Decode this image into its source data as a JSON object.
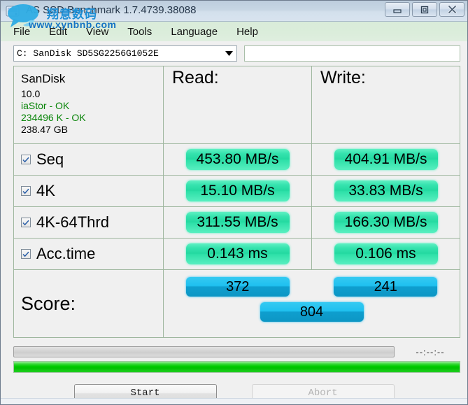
{
  "window": {
    "title": "AS SSD Benchmark 1.7.4739.38088",
    "minimize_label": "Minimize",
    "maximize_label": "Maximize",
    "close_label": "Close"
  },
  "watermark": {
    "chinese": "翔意数码",
    "url": "www.xynbnb.com",
    "color": "#1e8fd6"
  },
  "menu": {
    "items": [
      {
        "label": "File"
      },
      {
        "label": "Edit"
      },
      {
        "label": "View"
      },
      {
        "label": "Tools"
      },
      {
        "label": "Language"
      },
      {
        "label": "Help"
      }
    ]
  },
  "toolbar": {
    "drive_selected": "C: SanDisk SD5SG2256G1052E",
    "text_field_value": "",
    "text_field_placeholder": ""
  },
  "info": {
    "name": "SanDisk",
    "firmware": "10.0",
    "driver": "iaStor - OK",
    "alignment": "234496 K - OK",
    "capacity": "238.47 GB",
    "ok_color": "#078407"
  },
  "columns": {
    "read": "Read:",
    "write": "Write:"
  },
  "tests": [
    {
      "label": "Seq",
      "checked": true,
      "read": "453.80 MB/s",
      "write": "404.91 MB/s"
    },
    {
      "label": "4K",
      "checked": true,
      "read": "15.10 MB/s",
      "write": "33.83 MB/s"
    },
    {
      "label": "4K-64Thrd",
      "checked": true,
      "read": "311.55 MB/s",
      "write": "166.30 MB/s"
    },
    {
      "label": "Acc.time",
      "checked": true,
      "read": "0.143 ms",
      "write": "0.106 ms"
    }
  ],
  "score": {
    "label": "Score:",
    "read": "372",
    "write": "241",
    "total": "804"
  },
  "progress": {
    "timer": "--:--:--",
    "bar_value": 0,
    "green_value": 100,
    "green_color": "#00cc00"
  },
  "buttons": {
    "start": "Start",
    "abort": "Abort"
  },
  "colors": {
    "pill_green": "#23d9a0",
    "pill_blue": "#1fc0ef",
    "grid_border": "#9fb79f"
  }
}
